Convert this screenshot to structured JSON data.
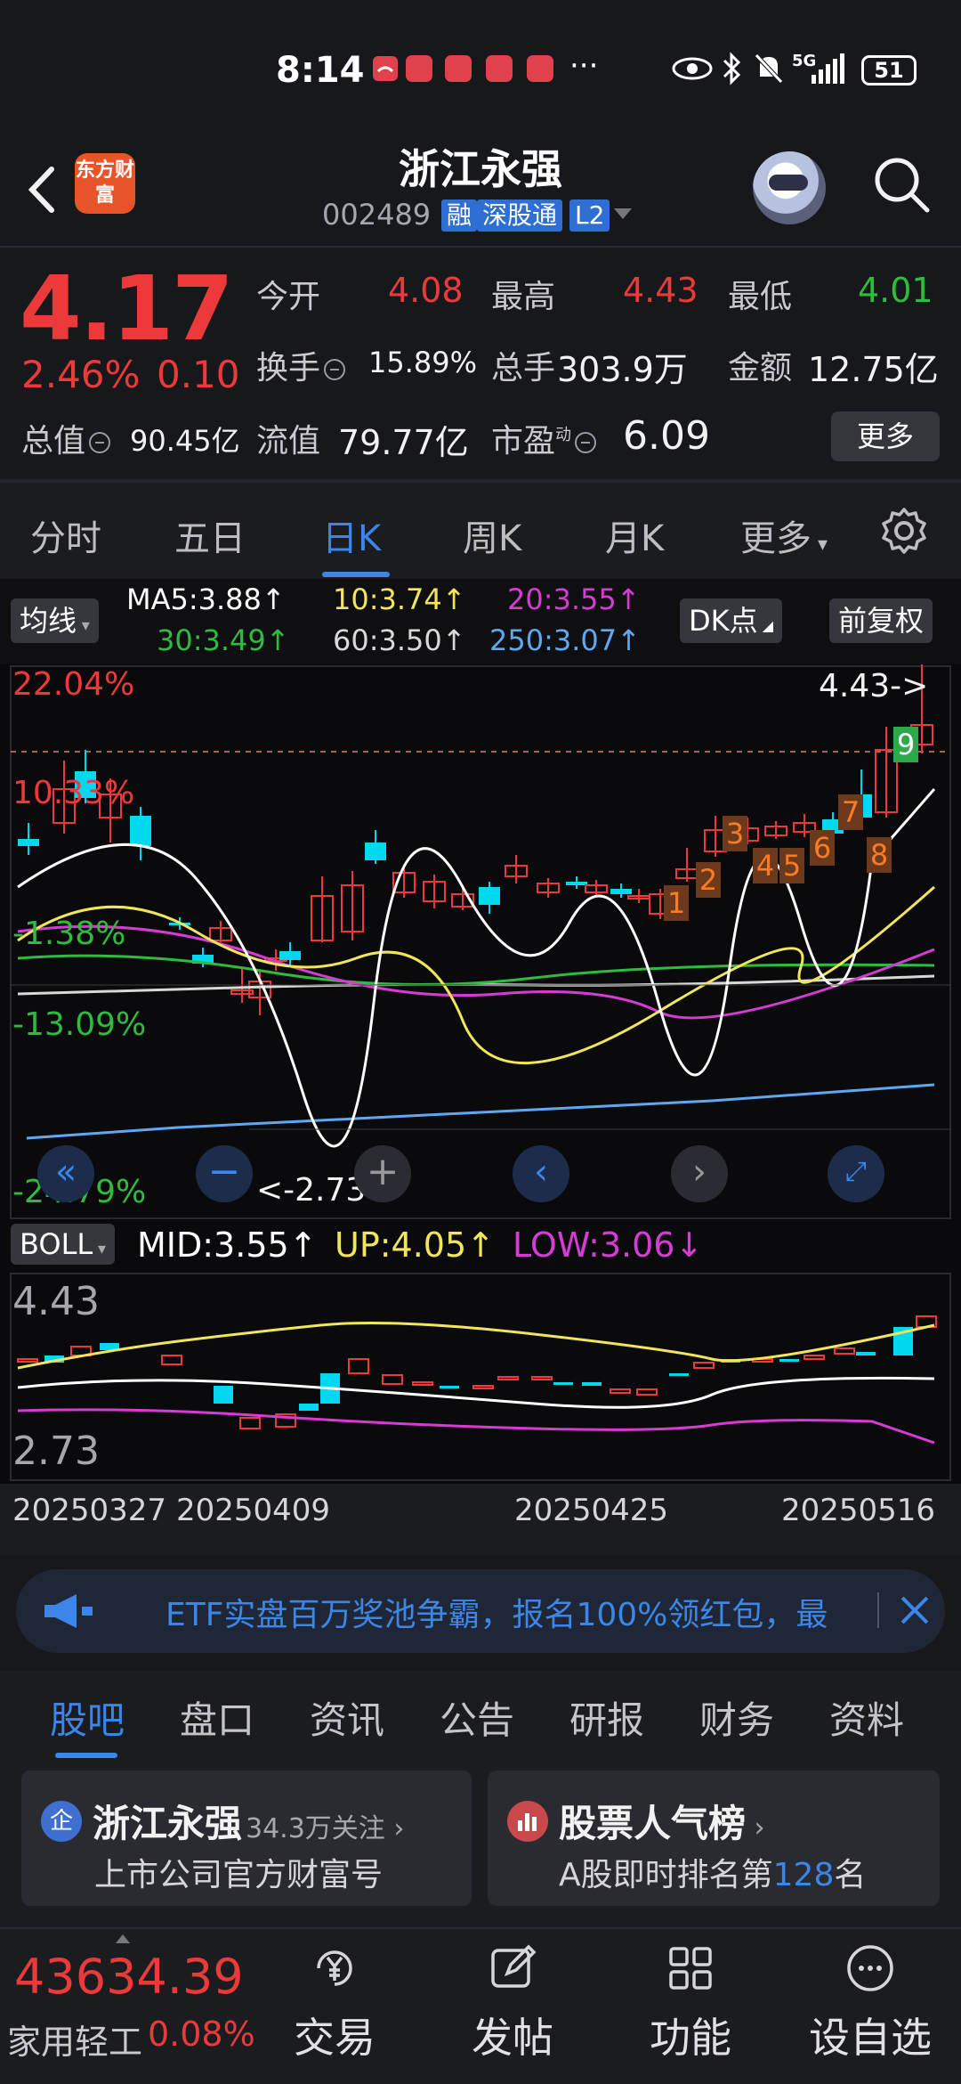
{
  "status_bar": {
    "time": "8:14",
    "dots": "···",
    "network": "5G",
    "battery": "51"
  },
  "header": {
    "app_logo_text": "东方财富",
    "stock_name": "浙江永强",
    "stock_code": "002489",
    "tags": [
      "融",
      "深股通",
      "L2"
    ]
  },
  "quote": {
    "price": "4.17",
    "change_pct": "2.46%",
    "change": "0.10",
    "rows": [
      [
        {
          "label": "今开",
          "value": "4.08",
          "color": "red"
        },
        {
          "label": "最高",
          "value": "4.43",
          "color": "red"
        },
        {
          "label": "最低",
          "value": "4.01",
          "color": "green"
        }
      ],
      [
        {
          "label": "换手",
          "value": "15.89%",
          "color": "white"
        },
        {
          "label": "总手",
          "value": "303.9万",
          "color": "white"
        },
        {
          "label": "金额",
          "value": "12.75亿",
          "color": "white"
        }
      ],
      [
        {
          "label": "总值",
          "value": "90.45亿",
          "color": "white"
        },
        {
          "label": "流值",
          "value": "79.77亿",
          "color": "white"
        },
        {
          "label": "市盈",
          "value": "6.09",
          "color": "white"
        }
      ]
    ],
    "pe_superscript": "动",
    "more_label": "更多"
  },
  "tabs": {
    "items": [
      "分时",
      "五日",
      "日K",
      "周K",
      "月K",
      "更多"
    ],
    "active": "日K"
  },
  "ma_legend": {
    "indicator": "均线",
    "ma5": "MA5:3.88",
    "ma10": "10:3.74",
    "ma20": "20:3.55",
    "ma30": "30:3.49",
    "ma60": "60:3.50",
    "ma250": "250:3.07",
    "dk_label": "DK点",
    "adjust_label": "前复权",
    "colors": {
      "ma5": "#ffffff",
      "ma10": "#f1e65b",
      "ma20": "#d63bd3",
      "ma30": "#2fbb3d",
      "ma60": "#d8d8d8",
      "ma250": "#5fa8f0"
    }
  },
  "main_chart": {
    "pct_labels": [
      "22.04%",
      "10.33%",
      "-1.38%",
      "-13.09%",
      "-24.79%"
    ],
    "high_label": "4.43->",
    "low_label": "<-2.73",
    "signal_numbers": [
      "1",
      "2",
      "3",
      "4",
      "5",
      "6",
      "7",
      "8"
    ],
    "signal_final": "9"
  },
  "boll": {
    "label": "BOLL",
    "mid": "MID:3.55",
    "up": "UP:4.05",
    "low": "LOW:3.06",
    "max_label": "4.43",
    "min_label": "2.73"
  },
  "dates": [
    "20250327",
    "20250409",
    "20250425",
    "20250516"
  ],
  "banner": {
    "text": "ETF实盘百万奖池争霸，报名100%领红包，最"
  },
  "bottom_tabs": {
    "items": [
      "股吧",
      "盘口",
      "资讯",
      "公告",
      "研报",
      "财务",
      "资料"
    ],
    "active": "股吧"
  },
  "cards": [
    {
      "icon_text": "企",
      "title": "浙江永强",
      "follow": "34.3万关注",
      "subtitle": "上市公司官方财富号"
    },
    {
      "title": "股票人气榜",
      "subtitle_prefix": "A股即时排名第",
      "rank": "128",
      "subtitle_suffix": "名"
    }
  ],
  "bottom_bar": {
    "index_value": "43634.39",
    "index_name": "家用轻工",
    "index_pct": "0.08%",
    "actions": [
      "交易",
      "发帖",
      "功能",
      "设自选"
    ]
  }
}
